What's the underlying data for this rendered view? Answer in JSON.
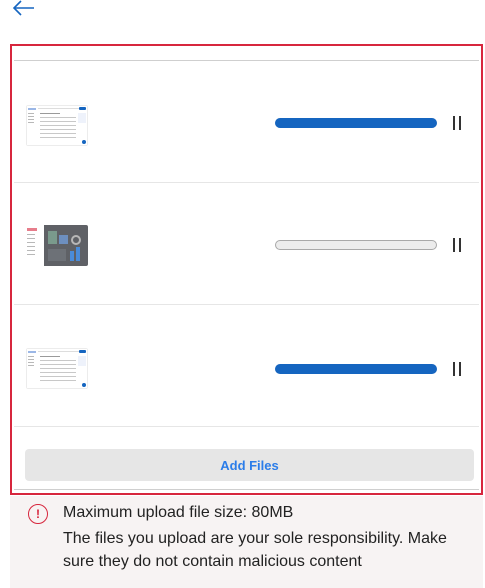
{
  "header": {
    "back_icon": "arrow-left-icon"
  },
  "uploads": [
    {
      "thumbnail": "document-screenshot-thumbnail",
      "progress": 1.0,
      "action_icon": "pause-icon"
    },
    {
      "thumbnail": "dashboard-screenshot-thumbnail",
      "progress": 0.0,
      "action_icon": "pause-icon"
    },
    {
      "thumbnail": "document-screenshot-thumbnail",
      "progress": 1.0,
      "action_icon": "pause-icon"
    }
  ],
  "add_files_label": "Add Files",
  "notice": {
    "icon": "exclamation-circle-icon",
    "icon_glyph": "!",
    "line1": "Maximum upload file size: 80MB",
    "line2": "The files you upload are your sole responsibility. Make sure they do not contain malicious content"
  },
  "colors": {
    "accent": "#1565c0",
    "link": "#2b7de9",
    "highlight_border": "#d7263d",
    "warning": "#d7263d"
  }
}
